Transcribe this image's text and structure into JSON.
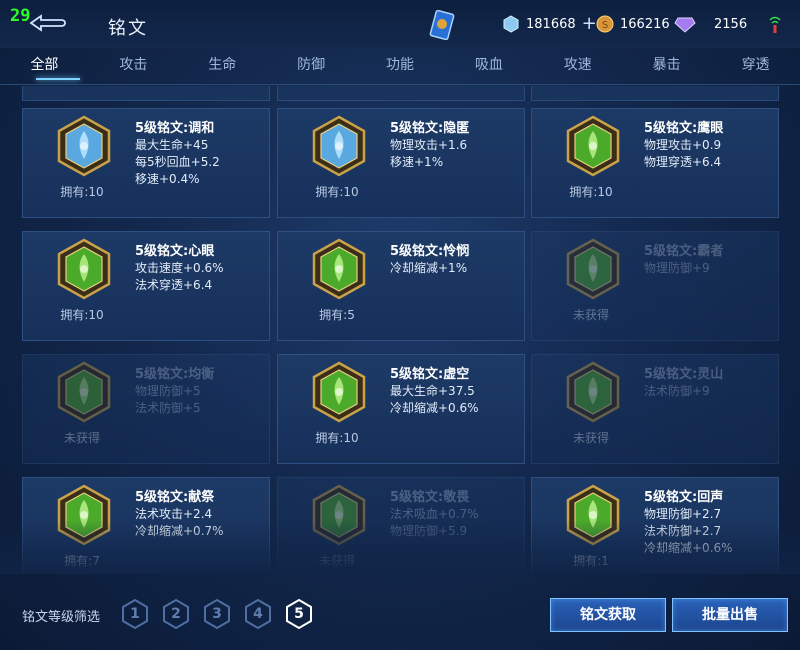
{
  "status": {
    "fps": "29"
  },
  "header": {
    "title": "铭文"
  },
  "currency": {
    "diamond": "181668",
    "gold": "166216",
    "gems": "2156"
  },
  "tabs": [
    "全部",
    "攻击",
    "生命",
    "防御",
    "功能",
    "吸血",
    "攻速",
    "暴击",
    "穿透"
  ],
  "active_tab": "全部",
  "cards": [
    {
      "name": "5级铭文:调和",
      "stats": [
        "最大生命+45",
        "每5秒回血+5.2",
        "移速+0.4%"
      ],
      "owned": "拥有:10",
      "state": "owned",
      "color": "blue",
      "icon": "drop-emblem-icon"
    },
    {
      "name": "5级铭文:隐匿",
      "stats": [
        "物理攻击+1.6",
        "移速+1%"
      ],
      "owned": "拥有:10",
      "state": "owned",
      "color": "blue",
      "icon": "flame-emblem-icon"
    },
    {
      "name": "5级铭文:鹰眼",
      "stats": [
        "物理攻击+0.9",
        "物理穿透+6.4"
      ],
      "owned": "拥有:10",
      "state": "owned",
      "color": "green",
      "icon": "clover-emblem-icon"
    },
    {
      "name": "5级铭文:心眼",
      "stats": [
        "攻击速度+0.6%",
        "法术穿透+6.4"
      ],
      "owned": "拥有:10",
      "state": "owned",
      "color": "green",
      "icon": "book-emblem-icon"
    },
    {
      "name": "5级铭文:怜悯",
      "stats": [
        "冷却缩减+1%"
      ],
      "owned": "拥有:5",
      "state": "owned",
      "color": "green",
      "icon": "star-emblem-icon"
    },
    {
      "name": "5级铭文:霸者",
      "stats": [
        "物理防御+9"
      ],
      "owned": "未获得",
      "state": "locked",
      "color": "green",
      "icon": "shield-emblem-icon"
    },
    {
      "name": "5级铭文:均衡",
      "stats": [
        "物理防御+5",
        "法术防御+5"
      ],
      "owned": "未获得",
      "state": "locked",
      "color": "green",
      "icon": "scale-emblem-icon"
    },
    {
      "name": "5级铭文:虚空",
      "stats": [
        "最大生命+37.5",
        "冷却缩减+0.6%"
      ],
      "owned": "拥有:10",
      "state": "owned",
      "color": "green",
      "icon": "crown-emblem-icon"
    },
    {
      "name": "5级铭文:灵山",
      "stats": [
        "法术防御+9"
      ],
      "owned": "未获得",
      "state": "locked",
      "color": "green",
      "icon": "mountain-emblem-icon"
    },
    {
      "name": "5级铭文:献祭",
      "stats": [
        "法术攻击+2.4",
        "冷却缩减+0.7%"
      ],
      "owned": "拥有:7",
      "state": "owned",
      "color": "green",
      "icon": "leaf-emblem-icon"
    },
    {
      "name": "5级铭文:敬畏",
      "stats": [
        "法术吸血+0.7%",
        "物理防御+5.9"
      ],
      "owned": "未获得",
      "state": "locked",
      "color": "green",
      "icon": "wing-emblem-icon"
    },
    {
      "name": "5级铭文:回声",
      "stats": [
        "物理防御+2.7",
        "法术防御+2.7",
        "冷却缩减+0.6%"
      ],
      "owned": "拥有:1",
      "state": "owned",
      "color": "green",
      "icon": "spiral-emblem-icon"
    }
  ],
  "footer": {
    "filter_label": "铭文等级筛选",
    "levels": [
      "1",
      "2",
      "3",
      "4",
      "5"
    ],
    "selected_level": "5",
    "get_button": "铭文获取",
    "sell_button": "批量出售"
  },
  "colors": {
    "accent": "#7fd3ff",
    "green_emblem": "#4caa2a",
    "blue_emblem": "#5aa8e0",
    "gold_frame": "#c9a24a"
  }
}
